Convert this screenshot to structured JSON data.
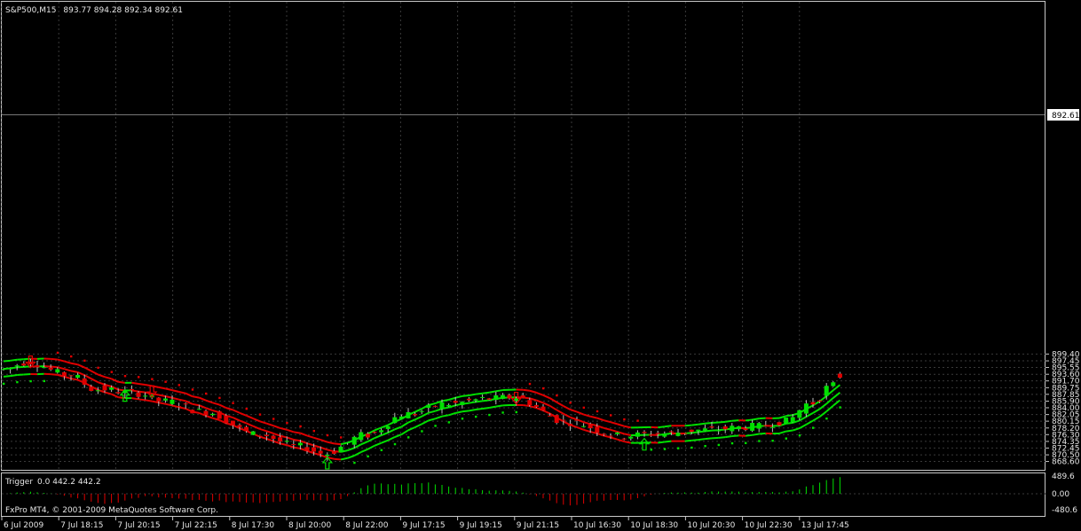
{
  "header": {
    "symbol": "S&P500,M15",
    "ohlc": "893.77 894.28 892.34 892.61"
  },
  "chart_data": {
    "type": "candlestick",
    "title": "S&P500,M15",
    "ylim": [
      866.2,
      1000.4
    ],
    "y_ticks": [
      "899.40",
      "897.45",
      "895.55",
      "893.60",
      "891.70",
      "889.75",
      "887.85",
      "885.90",
      "884.00",
      "882.05",
      "880.15",
      "878.20",
      "876.30",
      "874.35",
      "872.45",
      "870.50",
      "868.60"
    ],
    "current_price": "892.61",
    "x_labels": [
      "6 Jul 2009",
      "7 Jul 18:15",
      "7 Jul 20:15",
      "7 Jul 22:15",
      "8 Jul 17:30",
      "8 Jul 20:00",
      "8 Jul 22:00",
      "9 Jul 17:15",
      "9 Jul 19:15",
      "9 Jul 21:15",
      "10 Jul 16:30",
      "10 Jul 18:30",
      "10 Jul 20:30",
      "10 Jul 22:30",
      "13 Jul 17:45"
    ],
    "grid": true,
    "colors": {
      "background": "#000000",
      "grid": "#3a3a3a",
      "bull": "#00e000",
      "bear": "#e00000",
      "axis": "#c8c8c8",
      "text": "#e6e6e6"
    },
    "arrows_up": [
      {
        "index": 18,
        "price": 887.4
      },
      {
        "index": 48,
        "price": 868.0
      },
      {
        "index": 95,
        "price": 873.4
      }
    ],
    "arrows_down": [
      {
        "index": 4,
        "price": 897.3
      },
      {
        "index": 22,
        "price": 888.8
      },
      {
        "index": 76,
        "price": 886.9
      }
    ],
    "indicator": {
      "name": "Trigger",
      "values_label": "0.0 442.2 442.2",
      "y_ticks": [
        "489.6",
        "0.00",
        "-480.6"
      ],
      "ylim": [
        -480.6,
        489.6
      ]
    }
  },
  "footer": {
    "copyright": "FxPro MT4, © 2001-2009 MetaQuotes Software Corp."
  }
}
